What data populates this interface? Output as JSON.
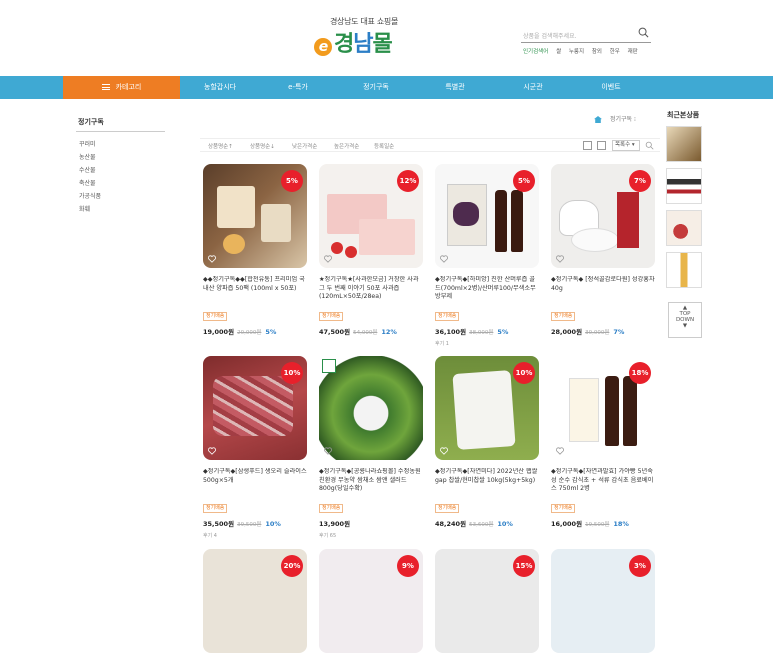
{
  "header": {
    "logo_sub": "경상남도 대표 쇼핑몰",
    "logo_e": "e",
    "logo_a": "경",
    "logo_b": "남",
    "logo_c": "몰",
    "search_placeholder": "상품을 검색해주세요.",
    "popular_label": "인기검색어",
    "popular": [
      "쌀",
      "누룽지",
      "참외",
      "한우",
      "재판"
    ]
  },
  "nav": {
    "category": "카테고리",
    "items": [
      "농할갑시다",
      "e-특가",
      "정기구독",
      "특별관",
      "시군관",
      "이벤트"
    ]
  },
  "sidebar": {
    "title": "정기구독",
    "items": [
      "꾸러미",
      "농산물",
      "수산물",
      "축산물",
      "가공식품",
      "화훼"
    ]
  },
  "breadcrumb": {
    "current": "정기구독"
  },
  "sort": {
    "options": [
      "상품명순↑",
      "상품명순↓",
      "낮은가격순",
      "높은가격순",
      "등록일순"
    ],
    "view_select": "목록수"
  },
  "products": [
    {
      "badge": "5%",
      "title": "◆◆정기구독◆◆[합천유통] 프리미엄 국내산 양파즙 50팩 (100ml x 50포)",
      "tag": "정기배송",
      "price": "19,000원",
      "orig": "20,000원",
      "rate": "5%",
      "review": ""
    },
    {
      "badge": "12%",
      "title": "★정기구독★[사과한모금] 거창한 사과 그 두 번째 이야기 50포 사과즙 (120mL×50포/28ea)",
      "tag": "정기배송",
      "price": "47,500원",
      "orig": "54,000원",
      "rate": "12%",
      "review": ""
    },
    {
      "badge": "5%",
      "title": "◆정기구독◆[하미앙] 진한 산머루즙 골드(700ml×2병)/산머루100/무색소무방부제",
      "tag": "정기배송",
      "price": "36,100원",
      "orig": "38,000원",
      "rate": "5%",
      "review": "후기 1"
    },
    {
      "badge": "7%",
      "title": "◆정기구독◆ [청석골감로다원] 성강홍차 40g",
      "tag": "정기배송",
      "price": "28,000원",
      "orig": "30,000원",
      "rate": "7%",
      "review": ""
    },
    {
      "badge": "10%",
      "title": "◆정기구독◆[삼생푸드] 생오리 슬라이스 500g×5개",
      "tag": "정기배송",
      "price": "35,500원",
      "orig": "39,500원",
      "rate": "10%",
      "review": "후기 4"
    },
    {
      "badge": "",
      "title": "◆정기구독◆[공룡나라쇼핑몰] 수정농원 친환경 무농약 쌈채소 쌈앤 샐러드 800g(당일수확)",
      "tag": "정기배송",
      "price": "13,900원",
      "orig": "",
      "rate": "",
      "review": "후기 65"
    },
    {
      "badge": "10%",
      "title": "◆정기구독◆[자연미다] 2022년산 햅쌀 gap 찹쌀/현미찹쌀 10kg(5kg+5kg)",
      "tag": "정기배송",
      "price": "48,240원",
      "orig": "53,600원",
      "rate": "10%",
      "review": ""
    },
    {
      "badge": "18%",
      "title": "◆정기구독◆[자연과발효] 가야빵 5년숙성 순수 감식초 + 석류 감식초 음료베이스 750ml 2병",
      "tag": "정기배송",
      "price": "16,000원",
      "orig": "19,500원",
      "rate": "18%",
      "review": ""
    },
    {
      "badge": "20%"
    },
    {
      "badge": "9%"
    },
    {
      "badge": "15%"
    },
    {
      "badge": "3%"
    }
  ],
  "recent": {
    "title": "최근본상품",
    "top": "TOP",
    "down": "DOWN"
  },
  "colors": {
    "nav": "#3fa9d3",
    "category": "#ee7d23",
    "badge": "#e8202b",
    "rate": "#2b7ec6"
  }
}
